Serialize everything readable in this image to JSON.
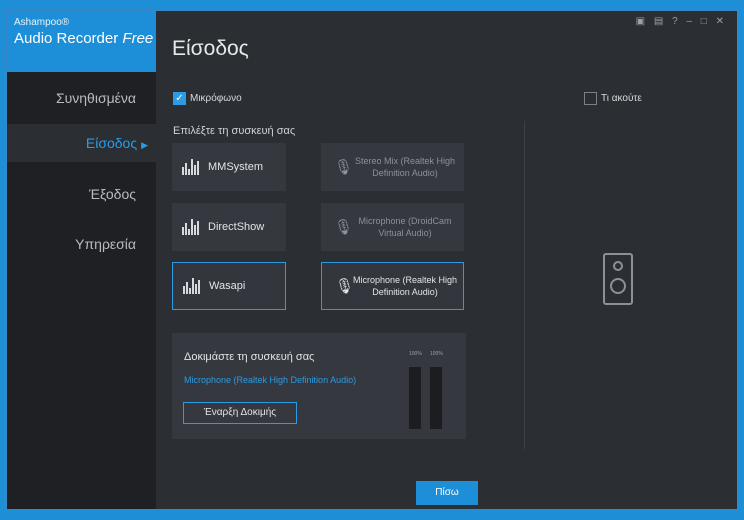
{
  "brand": {
    "company": "Ashampoo®",
    "product": "Audio Recorder",
    "edition": "Free"
  },
  "nav": [
    {
      "label": "Συνηθισμένα"
    },
    {
      "label": "Είσοδος"
    },
    {
      "label": "Έξοδος"
    },
    {
      "label": "Υπηρεσία"
    }
  ],
  "title": "Είσοδος",
  "microphone_checkbox": {
    "label": "Μικρόφωνο",
    "checked": true
  },
  "listen_checkbox": {
    "label": "Τι ακούτε",
    "checked": false
  },
  "select_device_label": "Επιλέξτε τη συσκευή σας",
  "drivers": [
    {
      "label": "MMSystem",
      "selected": false
    },
    {
      "label": "DirectShow",
      "selected": false
    },
    {
      "label": "Wasapi",
      "selected": true
    }
  ],
  "devices": [
    {
      "line1": "Stereo Mix (Realtek High",
      "line2": "Definition Audio)",
      "selected": false
    },
    {
      "line1": "Microphone (DroidCam",
      "line2": "Virtual Audio)",
      "selected": false
    },
    {
      "line1": "Microphone (Realtek High",
      "line2": "Definition Audio)",
      "selected": true
    }
  ],
  "test": {
    "title": "Δοκιμάστε τη συσκευή σας",
    "device": "Microphone (Realtek High Definition Audio)",
    "button": "Έναρξη Δοκιμής",
    "meter_left_label": "100%",
    "meter_right_label": "100%"
  },
  "back_button": "Πίσω",
  "icons": {
    "microphone": "microphone-icon",
    "driver": "levels-icon",
    "speaker": "speaker-icon"
  },
  "accent_color": "#2c9be4"
}
